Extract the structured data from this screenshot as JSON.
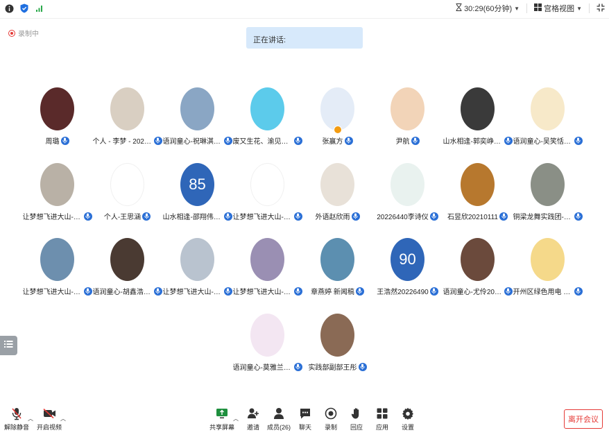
{
  "topbar": {
    "timer": "30:29(60分钟)",
    "view_mode": "宫格视图"
  },
  "recording_label": "录制中",
  "speaking_label": "正在讲话:",
  "participants": [
    {
      "name": "周璐",
      "avatar_color": "#5a2a2a"
    },
    {
      "name": "个人 - 李梦 - 20210...",
      "avatar_color": "#d9cfc2"
    },
    {
      "name": "语润童心-祝琳淇-20...",
      "avatar_color": "#8aa6c4"
    },
    {
      "name": "废又生花、渝见长江...",
      "avatar_color": "#5ccbeb"
    },
    {
      "name": "张赢方",
      "avatar_color": "#e4ecf7"
    },
    {
      "name": "尹航",
      "avatar_color": "#f2d4b8"
    },
    {
      "name": "山水相逢-郭奕峥-20...",
      "avatar_color": "#3a3a3a"
    },
    {
      "name": "语润童心-吴笑恬-20...",
      "avatar_color": "#f7e9c9"
    },
    {
      "name": "让梦想飞进大山-向...",
      "avatar_color": "#b9b1a6"
    },
    {
      "name": "个人-王思涵",
      "avatar_color": "#ffffff"
    },
    {
      "name": "山水相逢-邵翔伟-20...",
      "avatar_color": "#2f66b8",
      "number": "85"
    },
    {
      "name": "让梦想飞进大山-雷梓怡...",
      "avatar_color": "#ffffff"
    },
    {
      "name": "外语赵欣雨",
      "avatar_color": "#e8e1d8"
    },
    {
      "name": "20226440李诗仪",
      "avatar_color": "#e9f2ef"
    },
    {
      "name": "石昱欣20210111",
      "avatar_color": "#b7782e"
    },
    {
      "name": "铜梁龙舞实践团-贺...",
      "avatar_color": "#8a8f86"
    },
    {
      "name": "让梦想飞进大山-邱...",
      "avatar_color": "#6d8fae"
    },
    {
      "name": "语润童心-胡鑫浩-20...",
      "avatar_color": "#4a3a32"
    },
    {
      "name": "让梦想飞进大山-何鑫怡...",
      "avatar_color": "#b9c3cf"
    },
    {
      "name": "让梦想飞进大山-汪思靓...",
      "avatar_color": "#9a8fb3"
    },
    {
      "name": "章燕婷 新闻稿",
      "avatar_color": "#5c8fb0"
    },
    {
      "name": "王浩然20226490",
      "avatar_color": "#2f66b8",
      "number": "90"
    },
    {
      "name": "语润童心-尤伶2022...",
      "avatar_color": "#6b4a3c"
    },
    {
      "name": "开州区绿色用电 黎珍妮",
      "avatar_color": "#f5d98a"
    },
    {
      "name": "语润童心-莫雅兰-20...",
      "avatar_color": "#f3e6f2"
    },
    {
      "name": "实践部副部王彤",
      "avatar_color": "#8a6a55"
    }
  ],
  "toolbar": {
    "mute": "解除静音",
    "video": "开启视频",
    "share": "共享屏幕",
    "invite": "邀请",
    "members": "成员(26)",
    "chat": "聊天",
    "record": "录制",
    "reaction": "回应",
    "apps": "应用",
    "settings": "设置",
    "leave": "离开会议"
  }
}
